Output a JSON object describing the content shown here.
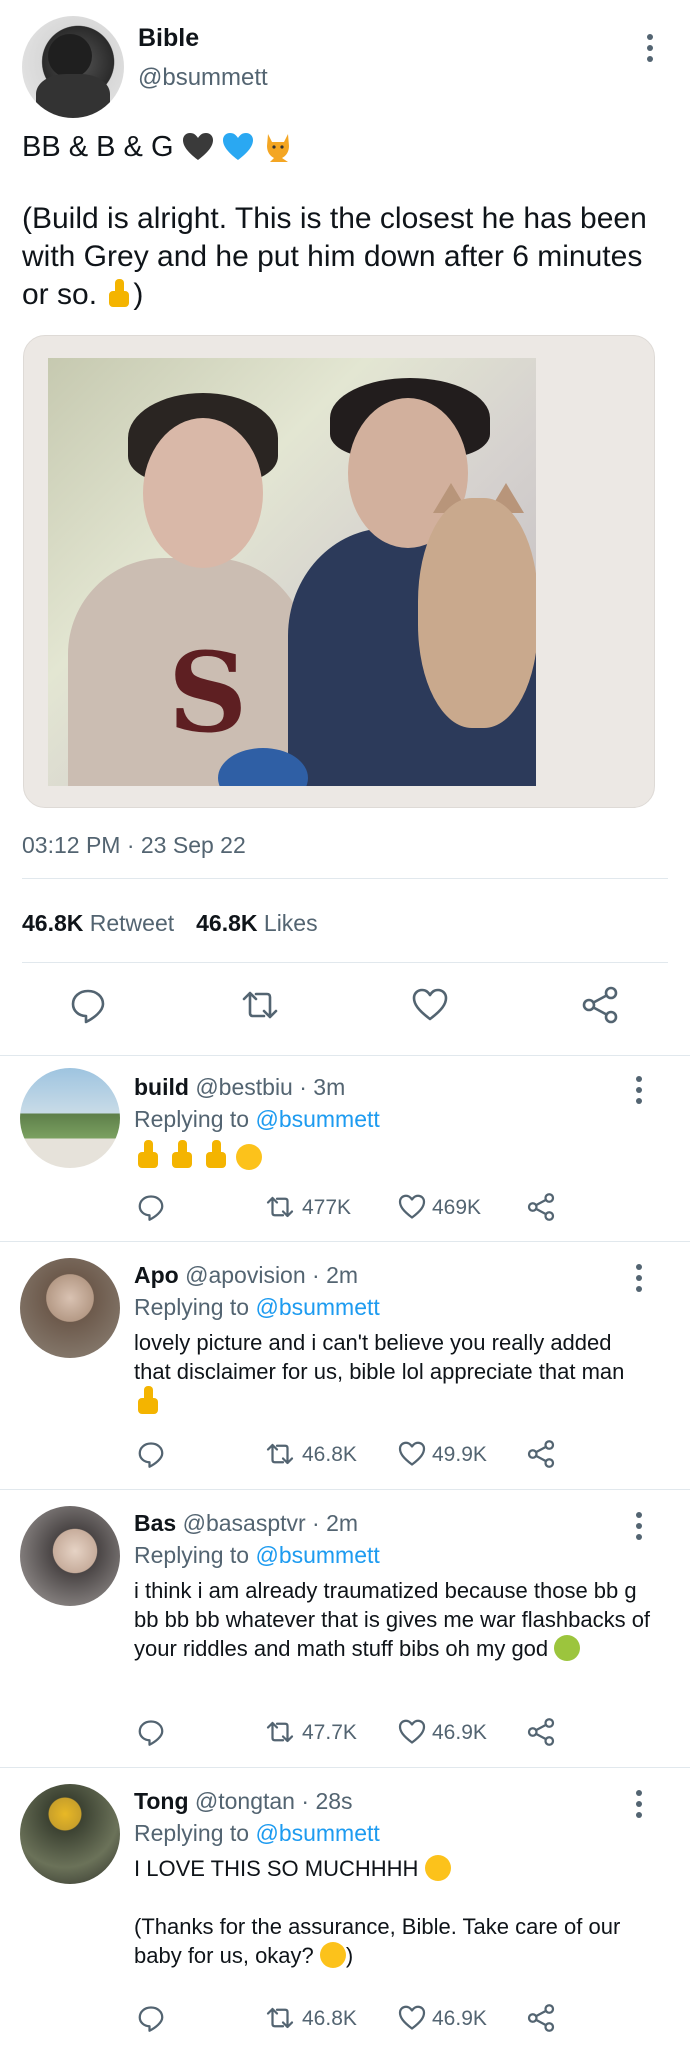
{
  "main_tweet": {
    "display_name": "Bible",
    "handle": "@bsummett",
    "line1": "BB & B & G",
    "body": "(Build is alright. This is the closest he has been with Grey and he put him down after 6 minutes or so.",
    "body_end": ")",
    "timestamp": "03:12 PM · 23 Sep 22",
    "retweets_count": "46.8K",
    "retweets_label": "Retweet",
    "likes_count": "46.8K",
    "likes_label": "Likes",
    "photo_letter": "S",
    "icons": {
      "reply": "reply-icon",
      "retweet": "retweet-icon",
      "like": "heart-icon",
      "share": "share-icon"
    }
  },
  "replies": [
    {
      "name": "build",
      "handle": "@bestbiu",
      "time": "3m",
      "replying_label": "Replying to",
      "replying_to": "@bsummett",
      "text": "",
      "retweets": "477K",
      "likes": "469K",
      "avatar_color": "#8aa86a"
    },
    {
      "name": "Apo",
      "handle": "@apovision",
      "time": "2m",
      "replying_label": "Replying to",
      "replying_to": "@bsummett",
      "text": "lovely picture and i can't believe you really added that disclaimer for us, bible lol appreciate that man",
      "retweets": "46.8K",
      "likes": "49.9K",
      "avatar_color": "#6d5a4c"
    },
    {
      "name": "Bas",
      "handle": "@basasptvr",
      "time": "2m",
      "replying_label": "Replying to",
      "replying_to": "@bsummett",
      "text": "i think i am already traumatized because those bb g bb bb bb whatever that is gives me war flashbacks of your riddles and math stuff bibs oh my god",
      "retweets": "47.7K",
      "likes": "46.9K",
      "avatar_color": "#5b5757"
    },
    {
      "name": "Tong",
      "handle": "@tongtan",
      "time": "28s",
      "replying_label": "Replying to",
      "replying_to": "@bsummett",
      "text": "I LOVE THIS SO MUCHHHH",
      "text2": "(Thanks for the assurance, Bible. Take care of our baby for us, okay?",
      "text2_end": ")",
      "retweets": "46.8K",
      "likes": "46.9K",
      "avatar_color": "#4a4f3a"
    }
  ],
  "colors": {
    "accent": "#1d9bf0",
    "muted": "#536471",
    "blue_heart": "#2aa8f2",
    "black_heart": "#3a3a3a"
  }
}
